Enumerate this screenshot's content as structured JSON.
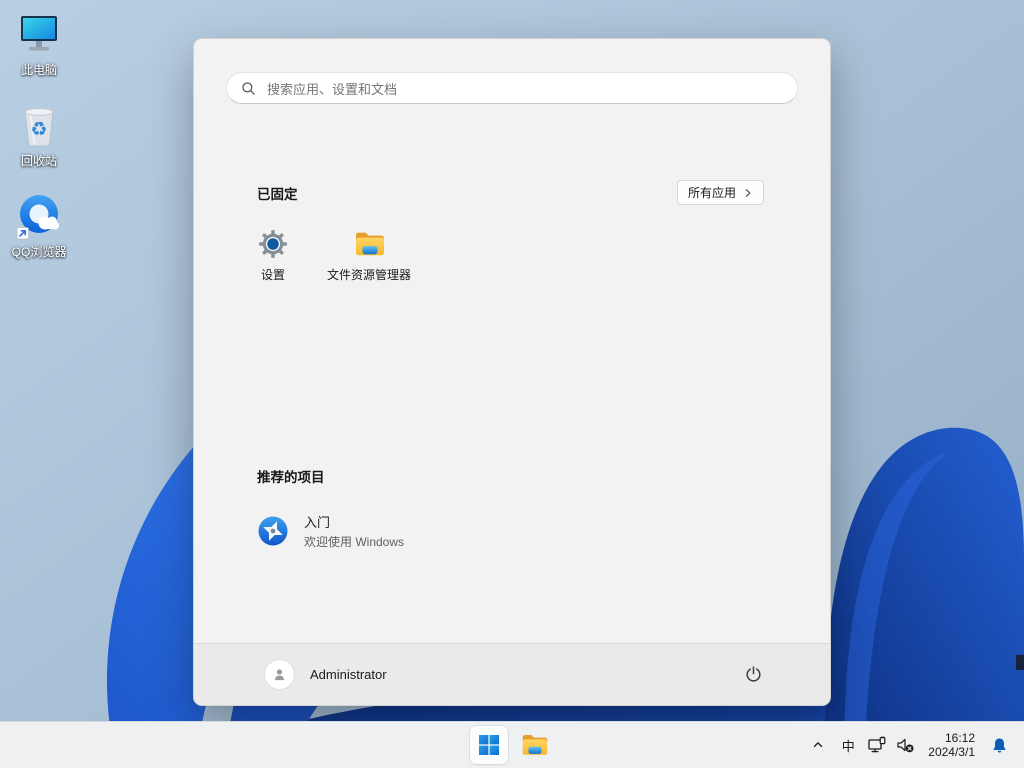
{
  "desktop": {
    "icons": [
      {
        "label": "此电脑",
        "icon": "this-pc"
      },
      {
        "label": "回收站",
        "icon": "recycle-bin"
      },
      {
        "label": "QQ浏览器",
        "icon": "qq-browser"
      }
    ]
  },
  "start_menu": {
    "search": {
      "placeholder": "搜索应用、设置和文档"
    },
    "pinned": {
      "header": "已固定",
      "all_apps_label": "所有应用",
      "apps": [
        {
          "label": "设置",
          "icon": "settings-gear"
        },
        {
          "label": "文件资源管理器",
          "icon": "file-explorer-folder"
        }
      ]
    },
    "recommended": {
      "header": "推荐的项目",
      "items": [
        {
          "title": "入门",
          "subtitle": "欢迎使用 Windows",
          "icon": "get-started-pinwheel"
        }
      ]
    },
    "user_bar": {
      "username": "Administrator"
    }
  },
  "taskbar": {
    "tray": {
      "ime": "中",
      "time": "16:12",
      "date": "2024/3/1"
    }
  },
  "icons": {
    "search-icon": "magnifying-glass",
    "all-apps-chevron-icon": "chevron-right",
    "settings-gear-icon": "gear-with-blue-center",
    "file-explorer-icon": "yellow-folder",
    "get-started-icon": "blue-pinwheel",
    "avatar-icon": "person-silhouette",
    "power-icon": "power-symbol",
    "start-icon": "windows-logo-four-squares",
    "tray-chevron-icon": "chevron-up",
    "network-icon": "monitor-with-ethernet-plug",
    "volume-icon": "speaker-muted",
    "bell-icon": "notification-bell-filled",
    "recycle-glyph": "♻"
  },
  "colors": {
    "accent_blue": "#0e7ad8",
    "bell_blue": "#0b5cb4",
    "menu_bg": "#f2f2f2",
    "taskbar_bg": "#eef0f1",
    "wallpaper_light": "#b9cfe3",
    "wallpaper_deep": "#0d2f80",
    "bloom_blue": "#2e74e8"
  }
}
